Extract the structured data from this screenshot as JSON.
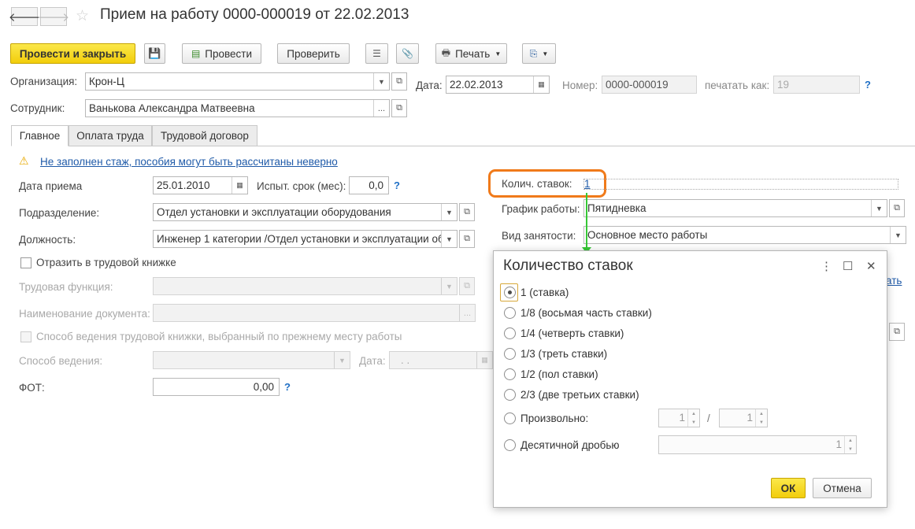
{
  "header": {
    "title": "Прием на работу 0000-000019 от 22.02.2013"
  },
  "toolbar": {
    "post_close": "Провести и закрыть",
    "post": "Провести",
    "check": "Проверить",
    "print": "Печать"
  },
  "form": {
    "org_label": "Организация:",
    "org_value": "Крон-Ц",
    "date_label": "Дата:",
    "date_value": "22.02.2013",
    "number_label": "Номер:",
    "number_value": "0000-000019",
    "print_as_label": "печатать как:",
    "print_as_value": "19",
    "employee_label": "Сотрудник:",
    "employee_value": "Ванькова Александра Матвеевна"
  },
  "tabs": [
    {
      "label": "Главное"
    },
    {
      "label": "Оплата труда"
    },
    {
      "label": "Трудовой договор"
    }
  ],
  "main": {
    "warning": "Не заполнен стаж, пособия могут быть рассчитаны неверно",
    "hire_date_label": "Дата приема",
    "hire_date_value": "25.01.2010",
    "probation_label": "Испыт. срок (мес):",
    "probation_value": "0,0",
    "dept_label": "Подразделение:",
    "dept_value": "Отдел установки и эксплуатации оборудования",
    "position_label": "Должность:",
    "position_value": "Инженер 1 категории /Отдел установки и эксплуатации об",
    "workbook_check": "Отразить в трудовой книжке",
    "labor_func_label": "Трудовая функция:",
    "doc_name_label": "Наименование документа:",
    "prev_method_check": "Способ ведения трудовой книжки, выбранный по прежнему месту работы",
    "method_label": "Способ ведения:",
    "date2_label": "Дата:",
    "date2_value": ". .",
    "fot_label": "ФОТ:",
    "fot_value": "0,00",
    "rates_label": "Колич. ставок:",
    "rates_value": "1",
    "schedule_label": "График работы:",
    "schedule_value": "Пятидневка",
    "employment_label": "Вид занятости:",
    "employment_value": "Основное место работы",
    "partial_link_tail": "ать"
  },
  "dialog": {
    "title": "Количество ставок",
    "options": [
      {
        "label": "1 (ставка)",
        "checked": true
      },
      {
        "label": "1/8 (восьмая часть ставки)"
      },
      {
        "label": "1/4 (четверть ставки)"
      },
      {
        "label": "1/3 (треть ставки)"
      },
      {
        "label": "1/2 (пол ставки)"
      },
      {
        "label": "2/3 (две третьих ставки)"
      },
      {
        "label": "Произвольно:"
      },
      {
        "label": "Десятичной дробью"
      }
    ],
    "numerator": "1",
    "slash": "/",
    "denominator": "1",
    "decimal": "1",
    "ok": "ОК",
    "cancel": "Отмена"
  },
  "colors": {
    "accent_yellow": "#f2cd0b",
    "highlight_orange": "#f07a1a",
    "connector_green": "#37c837",
    "link_blue": "#1f5aa8"
  }
}
